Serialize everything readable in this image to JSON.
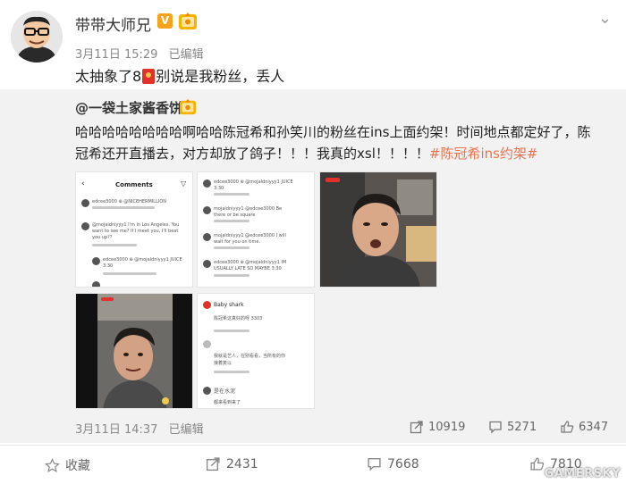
{
  "post": {
    "author": "带带大师兄",
    "verified_mark": "V",
    "date": "3月11日 15:29",
    "edited": "已编辑",
    "text_before": "太抽象了8",
    "text_after": "别说是我粉丝，丢人"
  },
  "repost": {
    "author": "@一袋土家酱香饼",
    "text": "哈哈哈哈哈哈哈哈啊哈哈陈冠希和孙笑川的粉丝在ins上面约架！时间地点都定好了，陈冠希还开直播去，对方却放了鸽子！！！我真的xsl！！！！",
    "hashtag": "#陈冠希ins约架#",
    "date": "3月11日 14:37",
    "edited": "已编辑",
    "stats": {
      "reposts": "10919",
      "comments": "5271",
      "likes": "6347"
    },
    "images": {
      "img1": {
        "title": "Comments",
        "lines": [
          "edcee3000 ⊕ @NICEHERMILLION",
          "@mojaldniyyy1 I'm in Los Angeles. You",
          "want to see me? If I meet you, I'll beat",
          "you up??",
          "edcee3000 ⊕ @mojaldniyyy1 JUICE",
          "3:30"
        ]
      },
      "img2": {
        "lines": [
          "edcee3000 ⊕ @mojaldniyyy1 JUICE",
          "3:30",
          "mojaldniyyy1 @edcee3000 Be",
          "there or be square",
          "mojaldniyyy1 @edcee3000 I will",
          "wait for you on time.",
          "edcee3000 ⊕ @mojaldniyyy1 IM",
          "USUALLY LATE SO MAYBE 3:30"
        ]
      },
      "img4": {
        "name": "Baby shark",
        "lines": [
          "陈冠希这真好的呀 3303",
          "我就是艺人，在别看看，当所有的你",
          "接着复以",
          "最后出现",
          "都来看到来了"
        ],
        "name2": "是在水泥"
      }
    }
  },
  "actions": {
    "favorite": "收藏",
    "repost": "2431",
    "comment": "7668",
    "like": "7810"
  },
  "watermark": "GAMERSKY"
}
